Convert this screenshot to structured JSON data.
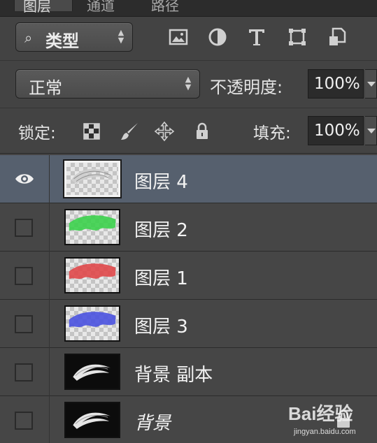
{
  "tabs": [
    {
      "label": "图层",
      "active": true
    },
    {
      "label": "通道",
      "active": false
    },
    {
      "label": "路径",
      "active": false
    }
  ],
  "filter": {
    "type_label": "类型",
    "icons": [
      "image-filter-icon",
      "adjustment-filter-icon",
      "type-filter-icon",
      "shape-filter-icon",
      "smart-object-filter-icon"
    ]
  },
  "blend": {
    "mode": "正常",
    "opacity_label": "不透明度:",
    "opacity_value": "100%"
  },
  "lock": {
    "label": "锁定:",
    "icons": [
      "lock-transparent-pixels-icon",
      "lock-image-pixels-icon",
      "lock-position-icon",
      "lock-all-icon"
    ],
    "fill_label": "填充:",
    "fill_value": "100%"
  },
  "layers": [
    {
      "name": "图层 4",
      "visible": true,
      "selected": true,
      "color": "#c8c8c8"
    },
    {
      "name": "图层 2",
      "visible": false,
      "selected": false,
      "color": "#3cd24c"
    },
    {
      "name": "图层 1",
      "visible": false,
      "selected": false,
      "color": "#e0484a"
    },
    {
      "name": "图层 3",
      "visible": false,
      "selected": false,
      "color": "#4a52e0"
    },
    {
      "name": "背景 副本",
      "visible": false,
      "selected": false,
      "color": "#e6e6e6"
    },
    {
      "name": "背景",
      "visible": false,
      "selected": false,
      "locked": true,
      "color": "#e6e6e6"
    }
  ],
  "watermark": {
    "main": "Bai经验",
    "sub": "jingyan.baidu.com"
  }
}
